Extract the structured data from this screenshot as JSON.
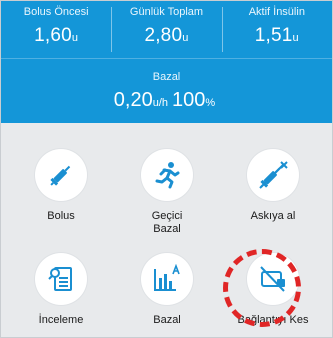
{
  "stats": [
    {
      "label": "Bolus Öncesi",
      "value": "1,60",
      "unit": "u"
    },
    {
      "label": "Günlük Toplam",
      "value": "2,80",
      "unit": "u"
    },
    {
      "label": "Aktif İnsülin",
      "value": "1,51",
      "unit": "u"
    }
  ],
  "basal": {
    "label": "Bazal",
    "rate": "0,20",
    "rate_unit": "u/h",
    "percent": "100",
    "percent_unit": "%"
  },
  "menu": [
    {
      "label": "Bolus",
      "icon": "syringe-icon"
    },
    {
      "label": "Geçici Bazal",
      "icon": "running-person-icon"
    },
    {
      "label": "Askıya al",
      "icon": "syringe-x-icon"
    },
    {
      "label": "İnceleme",
      "icon": "document-search-icon"
    },
    {
      "label": "Bazal",
      "icon": "basal-chart-icon"
    },
    {
      "label": "Bağlantıyı Kes",
      "icon": "disconnect-pump-icon"
    }
  ],
  "colors": {
    "header_blue": "#1496d8",
    "icon_blue": "#1a8fd1",
    "highlight_red": "#e02626",
    "background": "#e8eaec"
  }
}
